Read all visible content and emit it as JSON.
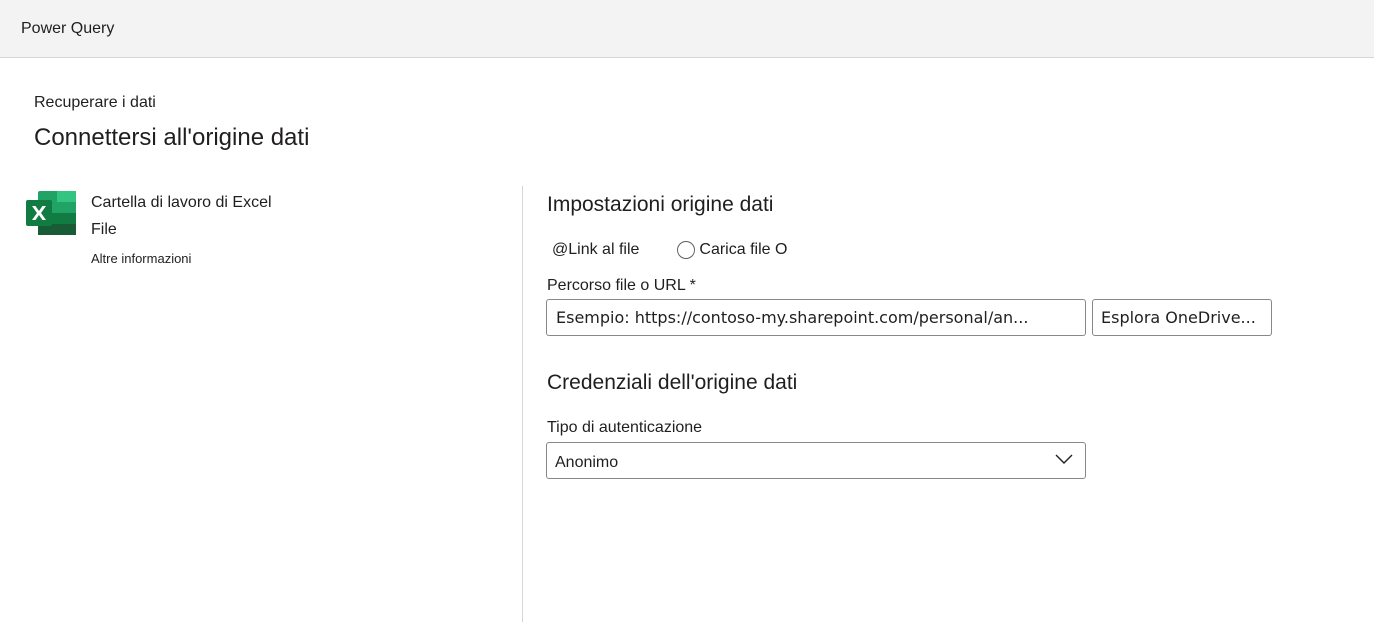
{
  "app": {
    "title": "Power Query"
  },
  "header": {
    "breadcrumb": "Recuperare i dati",
    "title": "Connettersi all'origine dati"
  },
  "connector": {
    "icon": "excel-icon",
    "name": "Cartella di lavoro di Excel",
    "category": "File",
    "more_info": "Altre informazioni"
  },
  "settings": {
    "title": "Impostazioni origine dati",
    "radio_options": [
      "@Link al file",
      "Carica file O"
    ],
    "path_label": "Percorso file o URL *",
    "path_placeholder": "Esempio: https://contoso-my.sharepoint.com/personal/an...",
    "browse_label": "Esplora OneDrive..."
  },
  "credentials": {
    "title": "Credenziali dell'origine dati",
    "auth_label": "Tipo di autenticazione",
    "auth_value": "Anonimo"
  },
  "colors": {
    "excel_green_dark": "#185c37",
    "excel_green": "#107c41",
    "excel_green_light": "#21a366",
    "excel_green_lighter": "#33c481"
  }
}
